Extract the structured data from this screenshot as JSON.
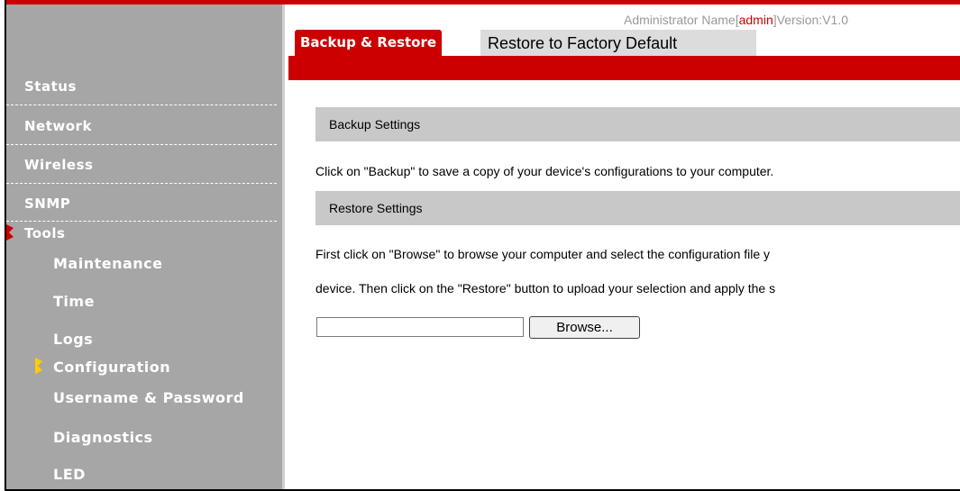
{
  "header": {
    "prefix": "Administrator Name[",
    "admin": "admin",
    "suffix": "]Version:V1.0"
  },
  "tabs": {
    "active": "Backup & Restore",
    "second": "Restore to Factory Default"
  },
  "sidebar": {
    "items": [
      "Status",
      "Network",
      "Wireless",
      "SNMP",
      "Tools"
    ],
    "tools_subitems": [
      "Maintenance",
      "Time",
      "Logs",
      "Configuration",
      "Username & Password",
      "Diagnostics",
      "LED"
    ],
    "active_section": "Tools",
    "active_subitem": "Configuration"
  },
  "main": {
    "backup_title": "Backup Settings",
    "backup_text": "Click on \"Backup\" to save a copy of your device's configurations to your computer.",
    "restore_title": "Restore Settings",
    "restore_text_1": "First click on \"Browse\" to browse your computer and select the configuration file y",
    "restore_text_2": "device. Then click on the \"Restore\" button to upload your selection and apply the s",
    "file_input_value": "",
    "browse_label": "Browse..."
  },
  "colors": {
    "accent": "#cc0000",
    "sidebar_bg": "#a6a6a6",
    "section_bg": "#c8c8c8",
    "marker_yellow": "#ffcc00"
  }
}
